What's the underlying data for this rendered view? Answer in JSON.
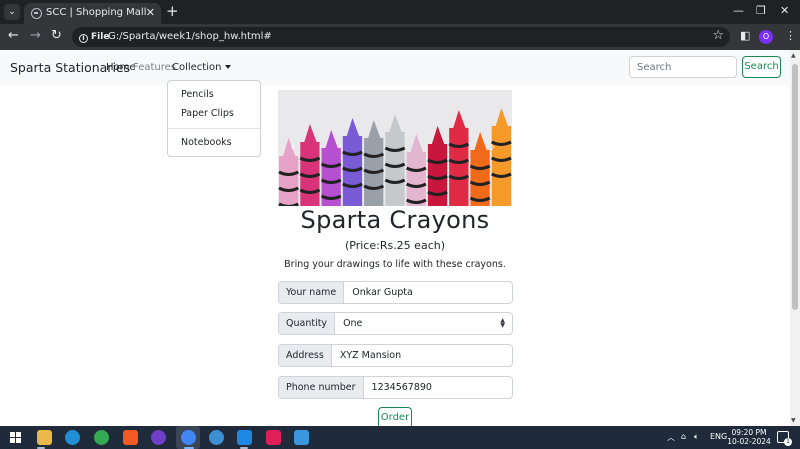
{
  "browser": {
    "tab_title": "SCC | Shopping Mall",
    "url_scheme_label": "File",
    "url": "G:/Sparta/week1/shop_hw.html#",
    "profile_initial": "O",
    "icons": [
      "tab-search-icon",
      "globe-icon",
      "close-icon",
      "plus-icon",
      "minimize-icon",
      "restore-icon",
      "back-icon",
      "forward-icon",
      "reload-icon",
      "info-icon",
      "star-icon",
      "sidebar-icon",
      "menu-icon"
    ]
  },
  "navbar": {
    "brand": "Sparta Stationaries",
    "links": [
      "Home",
      "Features",
      "Collection"
    ],
    "search_placeholder": "Search",
    "search_button": "Search"
  },
  "dropdown": {
    "items": [
      "Pencils",
      "Paper Clips",
      "Notebooks"
    ]
  },
  "product": {
    "title": "Sparta Crayons",
    "price": "(Price:Rs.25 each)",
    "description": "Bring your drawings to life with these crayons."
  },
  "form": {
    "name_label": "Your name",
    "name_value": "Onkar Gupta",
    "quantity_label": "Quantity",
    "quantity_value": "One",
    "address_label": "Address",
    "address_value": "XYZ Mansion",
    "phone_label": "Phone number",
    "phone_value": "1234567890",
    "submit": "Order"
  },
  "crayon_colors": [
    "#e6a3c7",
    "#d9347a",
    "#b64fd0",
    "#7a5bd6",
    "#9aa0a8",
    "#c6c9cc",
    "#e3b6cf",
    "#c8163d",
    "#e02a44",
    "#f06a1a",
    "#f39a2a"
  ],
  "taskbar": {
    "language": "ENG",
    "time": "09:20 PM",
    "date": "10-02-2024",
    "notification_count": "1"
  }
}
